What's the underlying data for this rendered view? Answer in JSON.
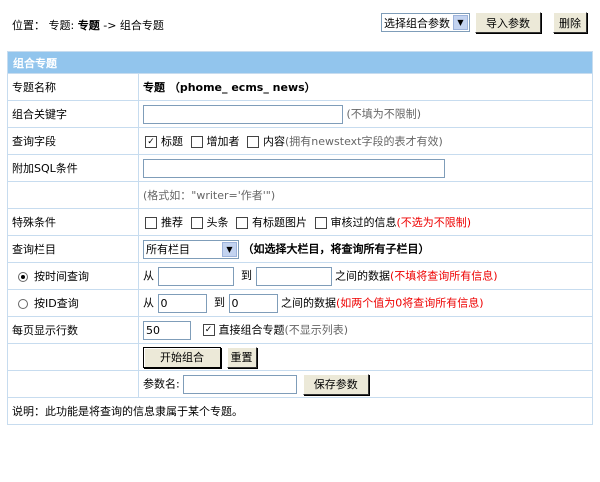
{
  "breadcrumb": {
    "prefix": "位置：",
    "link": "专题",
    "separator": ":",
    "current_bold": "专题",
    "arrow": "->",
    "page": "组合专题"
  },
  "toolbar": {
    "select_value": "选择组合参数",
    "import_label": "导入参数",
    "delete_label": "删除"
  },
  "form": {
    "header": "组合专题",
    "rows": {
      "topic_name": {
        "label": "专题名称",
        "value": "专题 （phome_ ecms_ news）"
      },
      "keyword": {
        "label": "组合关键字",
        "hint": "(不填为不限制)"
      },
      "query_field": {
        "label": "查询字段",
        "opt1": "标题",
        "opt2": "增加者",
        "opt3": "内容",
        "note": "(拥有newstext字段的表才有效)"
      },
      "sql": {
        "label": "附加SQL条件",
        "format": "(格式如：\"writer='作者'\")"
      },
      "special": {
        "label": "特殊条件",
        "opt1": "推荐",
        "opt2": "头条",
        "opt3": "有标题图片",
        "opt4": "审核过的信息",
        "note": "(不选为不限制)"
      },
      "column": {
        "label": "查询栏目",
        "select_value": "所有栏目",
        "note": "（如选择大栏目，将查询所有子栏目）"
      },
      "by_time": {
        "label": "按时间查询",
        "from": "从",
        "to": "到",
        "between": "之间的数据",
        "note": "(不填将查询所有信息)"
      },
      "by_id": {
        "label": "按ID查询",
        "from": "从",
        "from_value": "0",
        "to": "到",
        "to_value": "0",
        "between": "之间的数据",
        "note": "(如两个值为0将查询所有信息)"
      },
      "per_page": {
        "label": "每页显示行数",
        "value": "50",
        "direct_label": "直接组合专题",
        "direct_note": "(不显示列表)"
      },
      "actions": {
        "start_label": "开始组合",
        "reset_label": "重置"
      },
      "save": {
        "param_label": "参数名:",
        "save_label": "保存参数"
      }
    },
    "footer": "说明：此功能是将查询的信息隶属于某个专题。"
  },
  "colors": {
    "header_bg": "#92c5ed",
    "border": "#c7dcef",
    "red_note": "#e00000"
  }
}
